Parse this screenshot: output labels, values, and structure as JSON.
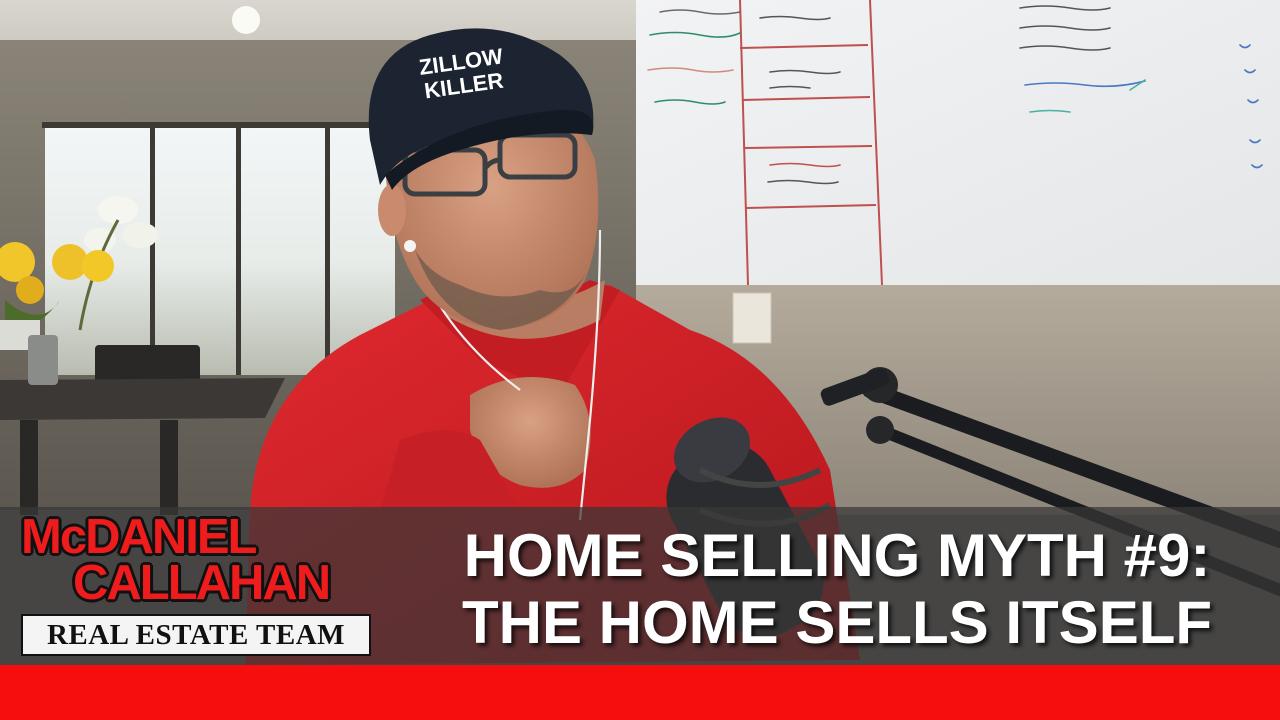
{
  "hat_text": [
    "ZILLOW",
    "KILLER"
  ],
  "logo": {
    "line1": "McDANIEL",
    "line2": "CALLAHAN",
    "plate": "REAL ESTATE TEAM"
  },
  "headline": {
    "line1": "HOME SELLING MYTH #9:",
    "line2": "THE HOME SELLS ITSELF"
  },
  "colors": {
    "brand_red": "#f60d0d",
    "shirt_red": "#d8222a",
    "banner_gray": "#373737",
    "text_white": "#ffffff"
  }
}
